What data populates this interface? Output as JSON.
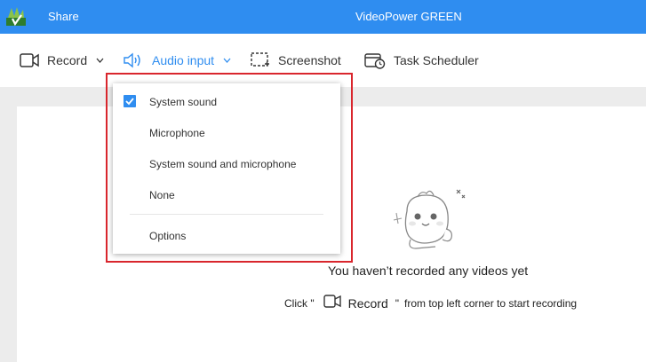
{
  "titlebar": {
    "share_label": "Share",
    "app_title": "VideoPower GREEN"
  },
  "toolbar": {
    "record_label": "Record",
    "audio_input_label": "Audio input",
    "screenshot_label": "Screenshot",
    "task_scheduler_label": "Task Scheduler"
  },
  "audio_menu": {
    "items": [
      {
        "label": "System sound",
        "checked": true
      },
      {
        "label": "Microphone",
        "checked": false
      },
      {
        "label": "System sound and microphone",
        "checked": false
      },
      {
        "label": "None",
        "checked": false
      }
    ],
    "options_label": "Options"
  },
  "empty_state": {
    "title": "You haven’t recorded any videos yet",
    "hint_pre": "Click \"",
    "hint_record": "Record",
    "hint_quote": "\"",
    "hint_post": "from top left corner to start recording"
  },
  "icons": {
    "logo": "app-logo-icon",
    "record": "video-camera-icon",
    "audio": "speaker-icon",
    "screenshot": "screenshot-crop-icon",
    "scheduler": "calendar-clock-icon",
    "check": "checkbox-checked-icon"
  },
  "colors": {
    "accent": "#2f8df0",
    "highlight": "#d9262d"
  }
}
